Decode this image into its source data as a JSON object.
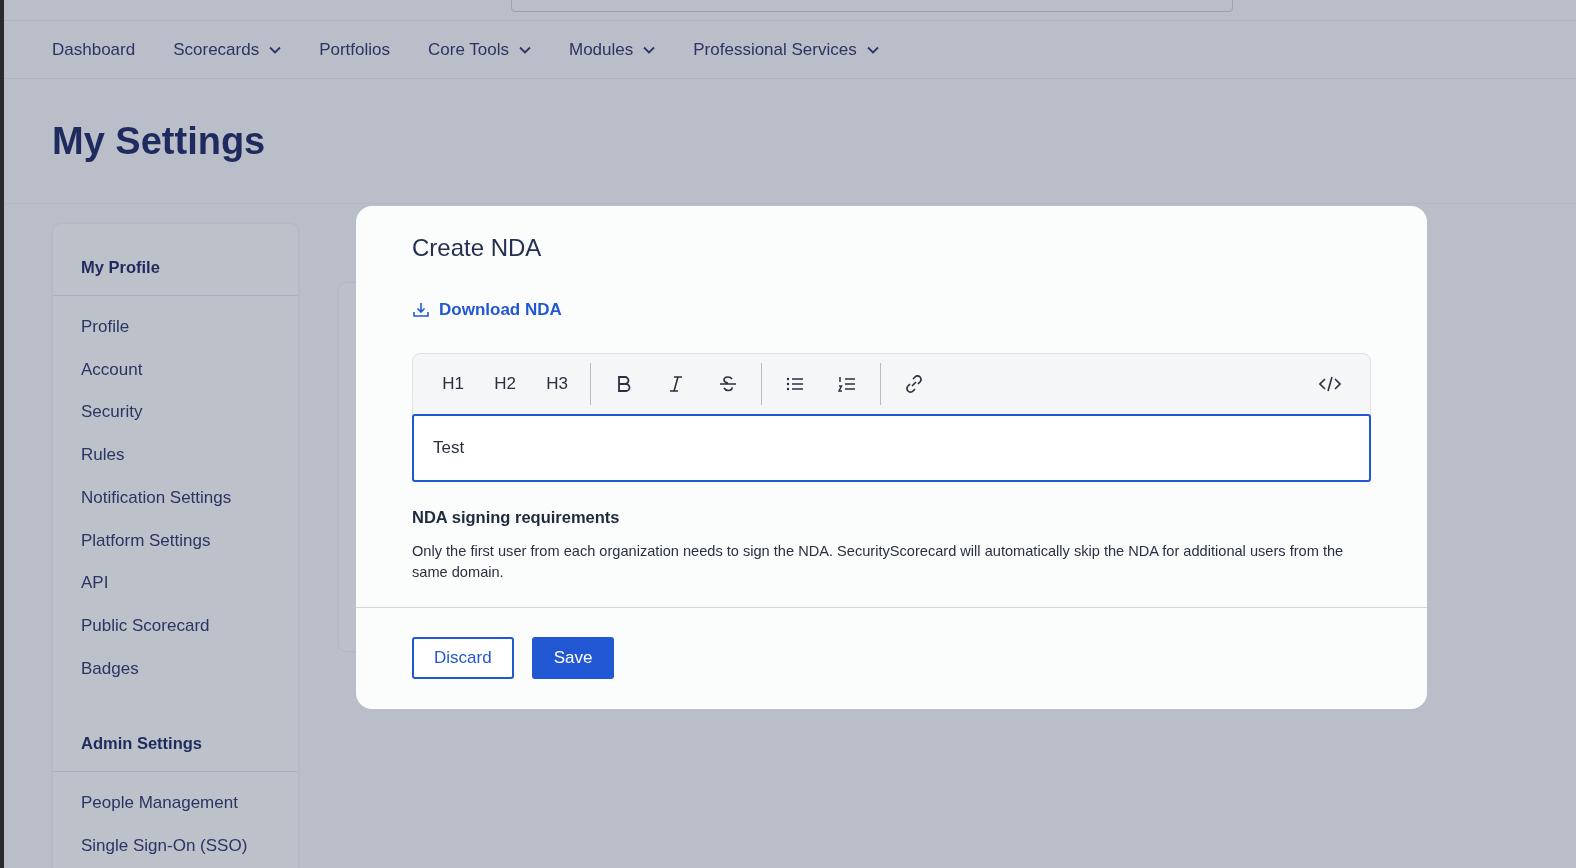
{
  "nav": [
    {
      "label": "Dashboard",
      "dropdown": false
    },
    {
      "label": "Scorecards",
      "dropdown": true
    },
    {
      "label": "Portfolios",
      "dropdown": false
    },
    {
      "label": "Core Tools",
      "dropdown": true
    },
    {
      "label": "Modules",
      "dropdown": true
    },
    {
      "label": "Professional Services",
      "dropdown": true
    }
  ],
  "page_title": "My Settings",
  "sidebar": [
    {
      "heading": "My Profile",
      "items": [
        "Profile",
        "Account",
        "Security",
        "Rules",
        "Notification Settings",
        "Platform Settings",
        "API",
        "Public Scorecard",
        "Badges"
      ]
    },
    {
      "heading": "Admin Settings",
      "items": [
        "People Management",
        "Single Sign-On (SSO)"
      ]
    }
  ],
  "modal": {
    "title": "Create NDA",
    "download_link": "Download NDA",
    "toolbar": [
      {
        "kind": "text",
        "label": "H1"
      },
      {
        "kind": "text",
        "label": "H2"
      },
      {
        "kind": "text",
        "label": "H3"
      },
      {
        "kind": "divider"
      },
      {
        "kind": "bold"
      },
      {
        "kind": "italic"
      },
      {
        "kind": "strike"
      },
      {
        "kind": "divider"
      },
      {
        "kind": "bullets"
      },
      {
        "kind": "numbers"
      },
      {
        "kind": "divider"
      },
      {
        "kind": "link"
      },
      {
        "kind": "spacer"
      },
      {
        "kind": "code"
      }
    ],
    "editor_value": "Test",
    "requirements_title": "NDA signing requirements",
    "requirements_text": "Only the first user from each organization needs to sign the NDA. SecurityScorecard will automatically skip the NDA for additional users from the same domain.",
    "buttons": [
      {
        "label": "Discard",
        "primary": false
      },
      {
        "label": "Save",
        "primary": true
      }
    ]
  }
}
